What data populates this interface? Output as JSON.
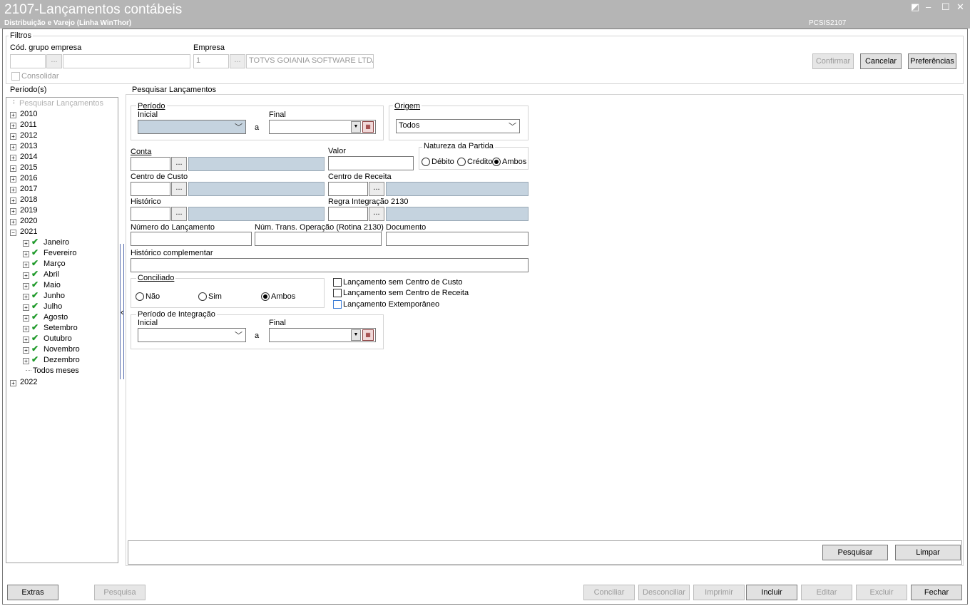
{
  "window": {
    "title": "2107-Lançamentos contábeis",
    "subtitle": "Distribuição e Varejo (Linha WinThor)",
    "code": "PCSIS2107",
    "controls": {
      "restore": "◩",
      "minimize": "–",
      "maximize": "☐",
      "close": "✕"
    }
  },
  "filters": {
    "group_title": "Filtros",
    "cod_grupo_label": "Cód. grupo empresa",
    "cod_grupo_value": "",
    "cod_grupo_desc": "",
    "empresa_label": "Empresa",
    "empresa_code": "1",
    "empresa_name": "TOTVS GOIANIA SOFTWARE LTDA",
    "consolidar_label": "Consolidar",
    "dots": "...",
    "confirmar": "Confirmar",
    "cancelar": "Cancelar",
    "preferencias": "Preferências"
  },
  "periodos": {
    "title": "Período(s)",
    "root_label": "Pesquisar Lançamentos",
    "years_before": [
      "2010",
      "2011",
      "2012",
      "2013",
      "2014",
      "2015",
      "2016",
      "2017",
      "2018",
      "2019",
      "2020"
    ],
    "expanded_year": "2021",
    "months": [
      "Janeiro",
      "Fevereiro",
      "Março",
      "Abril",
      "Maio",
      "Junho",
      "Julho",
      "Agosto",
      "Setembro",
      "Outubro",
      "Novembro",
      "Dezembro"
    ],
    "todos_meses": "Todos meses",
    "years_after": [
      "2022"
    ],
    "splitter_glyph": "‹"
  },
  "search": {
    "title": "Pesquisar Lançamentos",
    "periodo": {
      "title": "Período",
      "inicial": "Inicial",
      "final": "Final",
      "a": "a",
      "inicial_value": "",
      "final_value": ""
    },
    "origem": {
      "title": "Origem",
      "value": "Todos"
    },
    "conta": {
      "label": "Conta",
      "code": "",
      "desc": ""
    },
    "valor": {
      "label": "Valor",
      "value": ""
    },
    "natureza": {
      "title": "Natureza da Partida",
      "debito": "Débito",
      "credito": "Crédito",
      "ambos": "Ambos",
      "selected": "Ambos"
    },
    "centro_custo": {
      "label": "Centro de Custo"
    },
    "centro_receita": {
      "label": "Centro de Receita"
    },
    "historico": {
      "label": "Histórico"
    },
    "regra": {
      "label": "Regra Integração 2130"
    },
    "numero_lancamento": {
      "label": "Número do Lançamento"
    },
    "num_trans": {
      "label": "Núm. Trans. Operação (Rotina 2130)"
    },
    "documento": {
      "label": "Documento"
    },
    "historico_comp": {
      "label": "Histórico complementar"
    },
    "conciliado": {
      "title": "Conciliado",
      "nao": "Não",
      "sim": "Sim",
      "ambos": "Ambos",
      "selected": "Ambos"
    },
    "checks": {
      "sem_cc": "Lançamento sem Centro de Custo",
      "sem_cr": "Lançamento sem Centro de Receita",
      "extemporaneo": "Lançamento Extemporâneo"
    },
    "integracao": {
      "title": "Período de Integração",
      "inicial": "Inicial",
      "final": "Final",
      "a": "a"
    },
    "pesquisar": "Pesquisar",
    "limpar": "Limpar",
    "dots": "..."
  },
  "footer": {
    "extras": "Extras",
    "pesquisa": "Pesquisa",
    "conciliar": "Conciliar",
    "desconciliar": "Desconciliar",
    "imprimir": "Imprimir",
    "incluir": "Incluir",
    "editar": "Editar",
    "excluir": "Excluir",
    "fechar": "Fechar"
  }
}
